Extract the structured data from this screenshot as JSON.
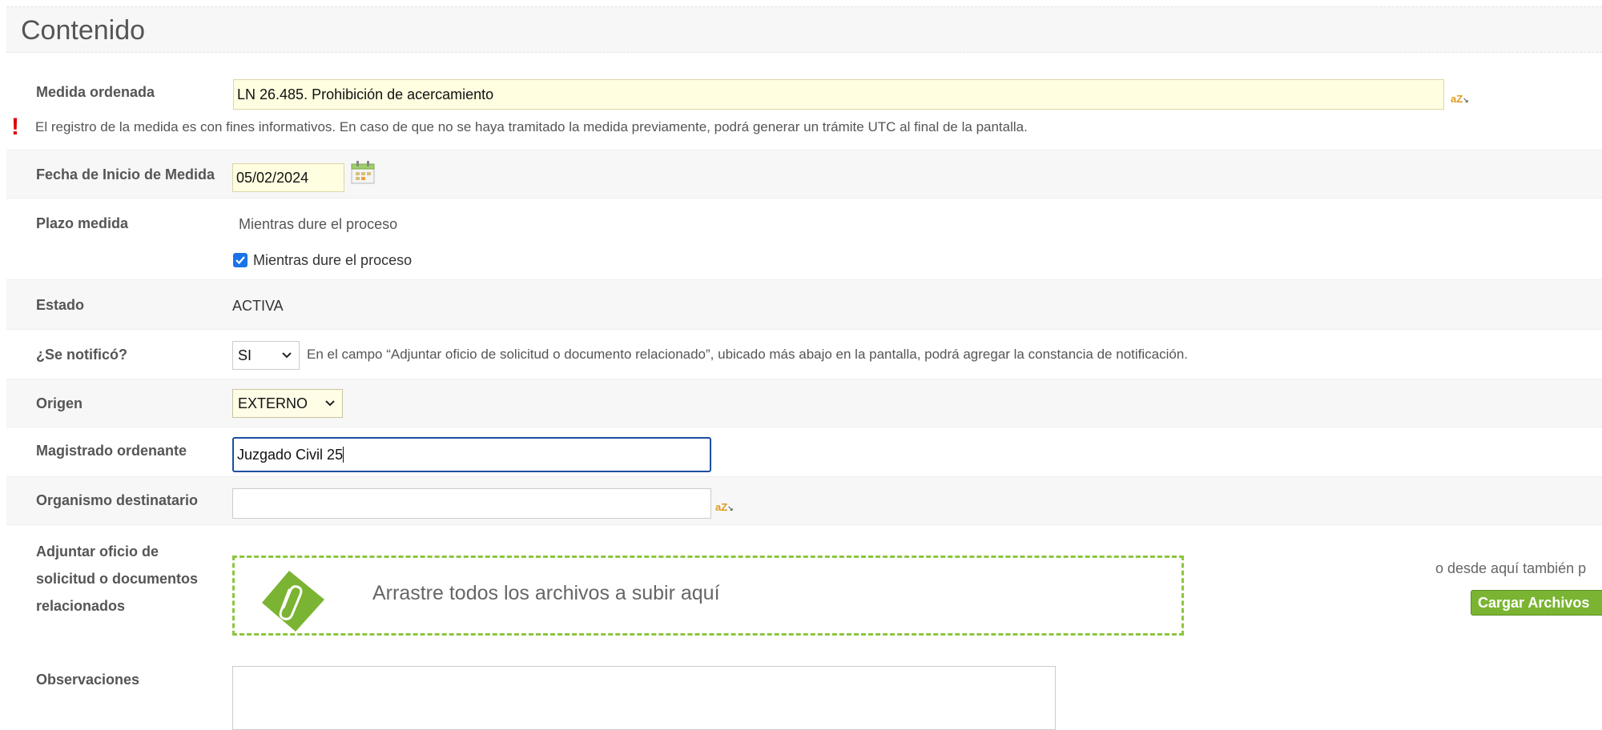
{
  "section": {
    "title": "Contenido"
  },
  "medida": {
    "label": "Medida ordenada",
    "value": "LN 26.485. Prohibición de acercamiento",
    "az": "aZ",
    "az_sub": "↘",
    "warning_mark": "!",
    "warning": "El registro de la medida es con fines informativos. En caso de que no se haya tramitado la medida previamente, podrá generar un trámite UTC al final de la pantalla."
  },
  "fecha": {
    "label": "Fecha de Inicio de Medida",
    "value": "05/02/2024"
  },
  "plazo": {
    "label": "Plazo medida",
    "text": "Mientras dure el proceso",
    "checkbox_label": "Mientras dure el proceso",
    "checked": true
  },
  "estado": {
    "label": "Estado",
    "value": "ACTIVA"
  },
  "notifico": {
    "label": "¿Se notificó?",
    "selected": "SI",
    "help": "En el campo “Adjuntar oficio de solicitud o documento relacionado”, ubicado más abajo en la pantalla, podrá agregar la constancia de notificación."
  },
  "origen": {
    "label": "Origen",
    "selected": "EXTERNO"
  },
  "magistrado": {
    "label": "Magistrado ordenante",
    "value": "Juzgado Civil 25"
  },
  "organismo": {
    "label": "Organismo destinatario",
    "value": "",
    "az": "aZ",
    "az_sub": "↘"
  },
  "adjuntar": {
    "label_line1": "Adjuntar oficio de",
    "label_line2": "solicitud o documentos",
    "label_line3": "relacionados",
    "dropzone_text": "Arrastre todos los archivos a subir aquí",
    "alt_text": "o desde aquí también p",
    "button": "Cargar Archivos",
    "dropzone_border": "#8cc63f",
    "button_color": "#7ab432"
  },
  "observaciones": {
    "label": "Observaciones",
    "value": ""
  },
  "icons": {
    "warning": "exclamation-icon",
    "calendar": "calendar-icon",
    "clip": "paperclip-icon",
    "chevron": "chevron-down-icon"
  }
}
